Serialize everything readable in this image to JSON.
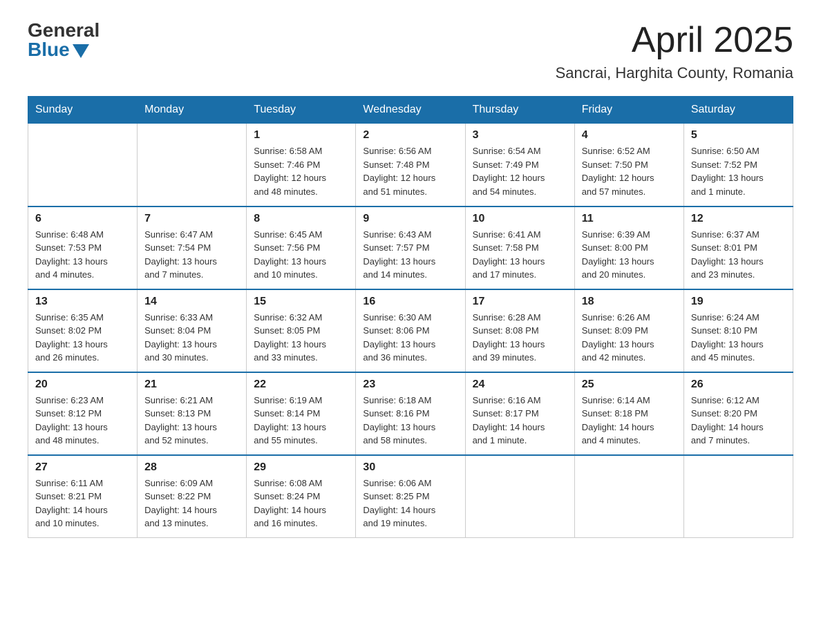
{
  "logo": {
    "general": "General",
    "blue": "Blue"
  },
  "header": {
    "month": "April 2025",
    "location": "Sancrai, Harghita County, Romania"
  },
  "weekdays": [
    "Sunday",
    "Monday",
    "Tuesday",
    "Wednesday",
    "Thursday",
    "Friday",
    "Saturday"
  ],
  "weeks": [
    [
      {
        "day": "",
        "info": ""
      },
      {
        "day": "",
        "info": ""
      },
      {
        "day": "1",
        "info": "Sunrise: 6:58 AM\nSunset: 7:46 PM\nDaylight: 12 hours\nand 48 minutes."
      },
      {
        "day": "2",
        "info": "Sunrise: 6:56 AM\nSunset: 7:48 PM\nDaylight: 12 hours\nand 51 minutes."
      },
      {
        "day": "3",
        "info": "Sunrise: 6:54 AM\nSunset: 7:49 PM\nDaylight: 12 hours\nand 54 minutes."
      },
      {
        "day": "4",
        "info": "Sunrise: 6:52 AM\nSunset: 7:50 PM\nDaylight: 12 hours\nand 57 minutes."
      },
      {
        "day": "5",
        "info": "Sunrise: 6:50 AM\nSunset: 7:52 PM\nDaylight: 13 hours\nand 1 minute."
      }
    ],
    [
      {
        "day": "6",
        "info": "Sunrise: 6:48 AM\nSunset: 7:53 PM\nDaylight: 13 hours\nand 4 minutes."
      },
      {
        "day": "7",
        "info": "Sunrise: 6:47 AM\nSunset: 7:54 PM\nDaylight: 13 hours\nand 7 minutes."
      },
      {
        "day": "8",
        "info": "Sunrise: 6:45 AM\nSunset: 7:56 PM\nDaylight: 13 hours\nand 10 minutes."
      },
      {
        "day": "9",
        "info": "Sunrise: 6:43 AM\nSunset: 7:57 PM\nDaylight: 13 hours\nand 14 minutes."
      },
      {
        "day": "10",
        "info": "Sunrise: 6:41 AM\nSunset: 7:58 PM\nDaylight: 13 hours\nand 17 minutes."
      },
      {
        "day": "11",
        "info": "Sunrise: 6:39 AM\nSunset: 8:00 PM\nDaylight: 13 hours\nand 20 minutes."
      },
      {
        "day": "12",
        "info": "Sunrise: 6:37 AM\nSunset: 8:01 PM\nDaylight: 13 hours\nand 23 minutes."
      }
    ],
    [
      {
        "day": "13",
        "info": "Sunrise: 6:35 AM\nSunset: 8:02 PM\nDaylight: 13 hours\nand 26 minutes."
      },
      {
        "day": "14",
        "info": "Sunrise: 6:33 AM\nSunset: 8:04 PM\nDaylight: 13 hours\nand 30 minutes."
      },
      {
        "day": "15",
        "info": "Sunrise: 6:32 AM\nSunset: 8:05 PM\nDaylight: 13 hours\nand 33 minutes."
      },
      {
        "day": "16",
        "info": "Sunrise: 6:30 AM\nSunset: 8:06 PM\nDaylight: 13 hours\nand 36 minutes."
      },
      {
        "day": "17",
        "info": "Sunrise: 6:28 AM\nSunset: 8:08 PM\nDaylight: 13 hours\nand 39 minutes."
      },
      {
        "day": "18",
        "info": "Sunrise: 6:26 AM\nSunset: 8:09 PM\nDaylight: 13 hours\nand 42 minutes."
      },
      {
        "day": "19",
        "info": "Sunrise: 6:24 AM\nSunset: 8:10 PM\nDaylight: 13 hours\nand 45 minutes."
      }
    ],
    [
      {
        "day": "20",
        "info": "Sunrise: 6:23 AM\nSunset: 8:12 PM\nDaylight: 13 hours\nand 48 minutes."
      },
      {
        "day": "21",
        "info": "Sunrise: 6:21 AM\nSunset: 8:13 PM\nDaylight: 13 hours\nand 52 minutes."
      },
      {
        "day": "22",
        "info": "Sunrise: 6:19 AM\nSunset: 8:14 PM\nDaylight: 13 hours\nand 55 minutes."
      },
      {
        "day": "23",
        "info": "Sunrise: 6:18 AM\nSunset: 8:16 PM\nDaylight: 13 hours\nand 58 minutes."
      },
      {
        "day": "24",
        "info": "Sunrise: 6:16 AM\nSunset: 8:17 PM\nDaylight: 14 hours\nand 1 minute."
      },
      {
        "day": "25",
        "info": "Sunrise: 6:14 AM\nSunset: 8:18 PM\nDaylight: 14 hours\nand 4 minutes."
      },
      {
        "day": "26",
        "info": "Sunrise: 6:12 AM\nSunset: 8:20 PM\nDaylight: 14 hours\nand 7 minutes."
      }
    ],
    [
      {
        "day": "27",
        "info": "Sunrise: 6:11 AM\nSunset: 8:21 PM\nDaylight: 14 hours\nand 10 minutes."
      },
      {
        "day": "28",
        "info": "Sunrise: 6:09 AM\nSunset: 8:22 PM\nDaylight: 14 hours\nand 13 minutes."
      },
      {
        "day": "29",
        "info": "Sunrise: 6:08 AM\nSunset: 8:24 PM\nDaylight: 14 hours\nand 16 minutes."
      },
      {
        "day": "30",
        "info": "Sunrise: 6:06 AM\nSunset: 8:25 PM\nDaylight: 14 hours\nand 19 minutes."
      },
      {
        "day": "",
        "info": ""
      },
      {
        "day": "",
        "info": ""
      },
      {
        "day": "",
        "info": ""
      }
    ]
  ]
}
